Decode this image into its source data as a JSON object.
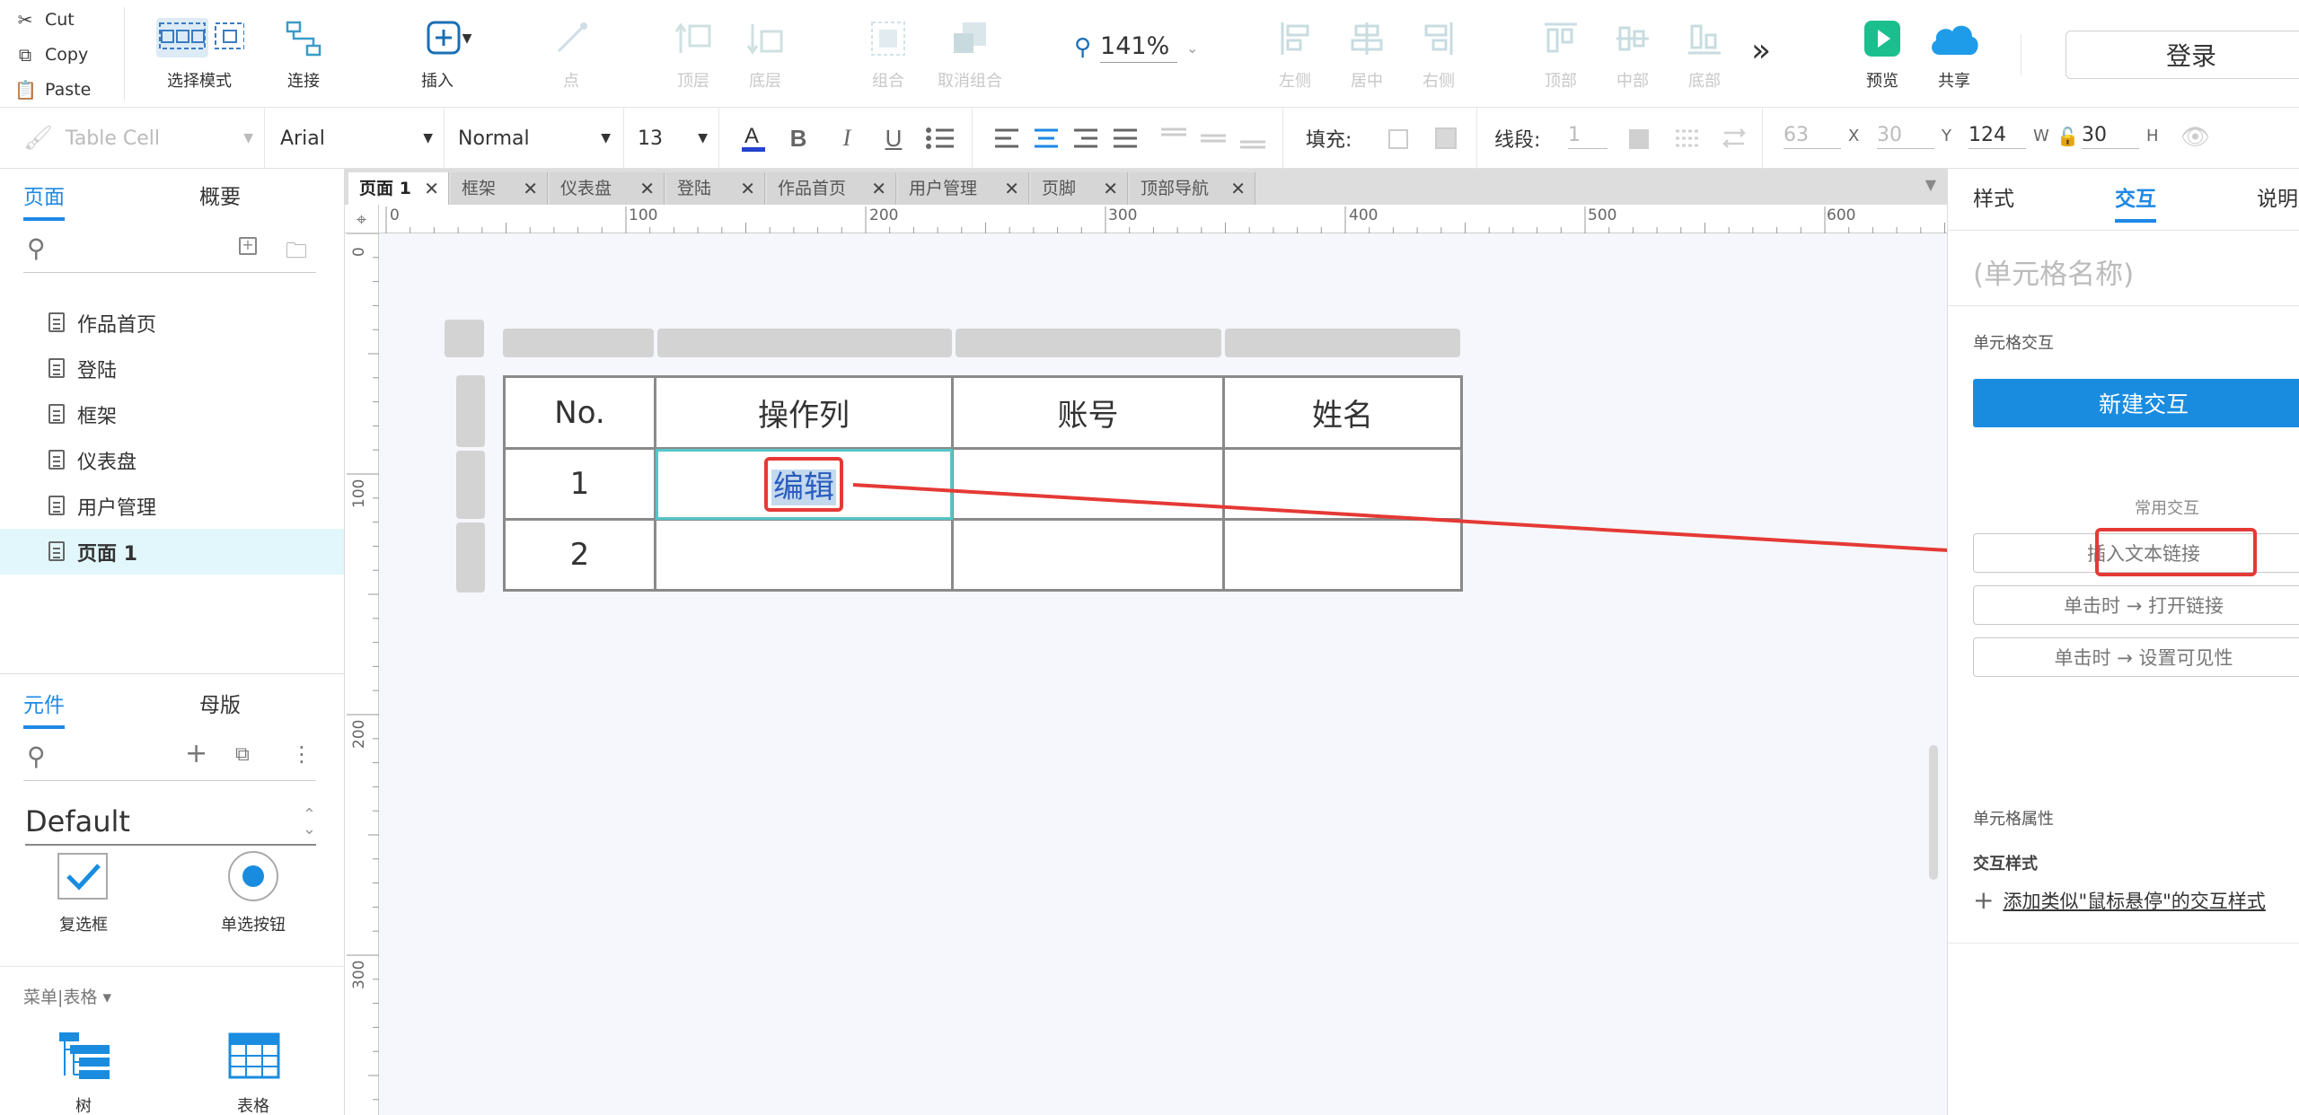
{
  "toolbar": {
    "clipboard": [
      {
        "icon": "scissors-icon",
        "label": "Cut"
      },
      {
        "icon": "copy-icon",
        "label": "Copy"
      },
      {
        "icon": "paste-icon",
        "label": "Paste"
      }
    ],
    "select_mode": "选择模式",
    "connect": "连接",
    "insert": "插入",
    "point": "点",
    "top_layer": "顶层",
    "bottom_layer": "底层",
    "group": "组合",
    "ungroup": "取消组合",
    "zoom": "141%",
    "align_left": "左侧",
    "align_center": "居中",
    "align_right": "右侧",
    "align_top": "顶部",
    "align_middle": "中部",
    "align_bottom": "底部",
    "more": "»",
    "preview": "预览",
    "share": "共享",
    "login": "登录"
  },
  "format": {
    "style_name": "Table Cell",
    "font": "Arial",
    "weight": "Normal",
    "size": "13",
    "fill_label": "填充:",
    "stroke_label": "线段:",
    "stroke_value": "1",
    "x": "63",
    "x_unit": "X",
    "y": "30",
    "y_unit": "Y",
    "w": "124",
    "w_unit": "W",
    "h": "30",
    "h_unit": "H"
  },
  "left": {
    "tabs": [
      "页面",
      "概要"
    ],
    "pages": [
      "作品首页",
      "登陆",
      "框架",
      "仪表盘",
      "用户管理",
      "页面 1"
    ],
    "widget_tabs": [
      "元件",
      "母版"
    ],
    "library": "Default",
    "widgets": [
      {
        "icon": "checkbox-icon",
        "label": "复选框"
      },
      {
        "icon": "radio-icon",
        "label": "单选按钮"
      }
    ],
    "category": "菜单|表格 ▾",
    "menu_widgets": [
      {
        "icon": "tree-icon",
        "label": "树"
      },
      {
        "icon": "table-icon",
        "label": "表格"
      }
    ]
  },
  "doc_tabs": [
    "页面 1",
    "框架",
    "仪表盘",
    "登陆",
    "作品首页",
    "用户管理",
    "页脚",
    "顶部导航"
  ],
  "ruler": {
    "h": [
      "0",
      "100",
      "200",
      "300",
      "400",
      "500",
      "600"
    ],
    "v": [
      "0",
      "100",
      "200",
      "300"
    ]
  },
  "table": {
    "headers": [
      "No.",
      "操作列",
      "账号",
      "姓名"
    ],
    "rows": [
      [
        "1",
        "编辑",
        "",
        ""
      ],
      [
        "2",
        "",
        "",
        ""
      ]
    ]
  },
  "right": {
    "tabs": [
      "样式",
      "交互",
      "说明"
    ],
    "cell_name_placeholder": "(单元格名称)",
    "cell_interaction": "单元格交互",
    "new_interaction": "新建交互",
    "common_interactions": "常用交互",
    "quick": [
      "插入文本链接",
      "单击时 → 打开链接",
      "单击时 → 设置可见性"
    ],
    "cell_properties": "单元格属性",
    "interaction_style": "交互样式",
    "add_style": "添加类似\"鼠标悬停\"的交互样式"
  },
  "colors": {
    "accent": "#1e88e5",
    "highlight": "#e53935",
    "selection": "#56c5c8"
  }
}
